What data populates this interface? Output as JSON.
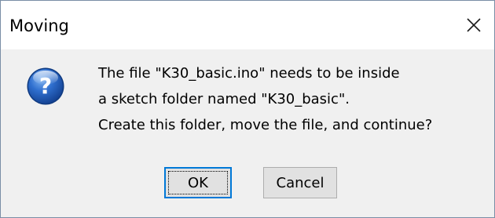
{
  "window": {
    "title": "Moving",
    "close_icon": "close-icon"
  },
  "dialog": {
    "icon": "question-icon",
    "message_lines": [
      "The file \"K30_basic.ino\" needs to be inside",
      "a sketch folder named \"K30_basic\".",
      "Create this folder, move the file, and continue?"
    ]
  },
  "buttons": {
    "ok_label": "OK",
    "cancel_label": "Cancel"
  },
  "colors": {
    "dialog_bg": "#f0f0f0",
    "titlebar_bg": "#ffffff",
    "focus_border": "#0078d7",
    "icon_blue": "#1f5fb8"
  }
}
